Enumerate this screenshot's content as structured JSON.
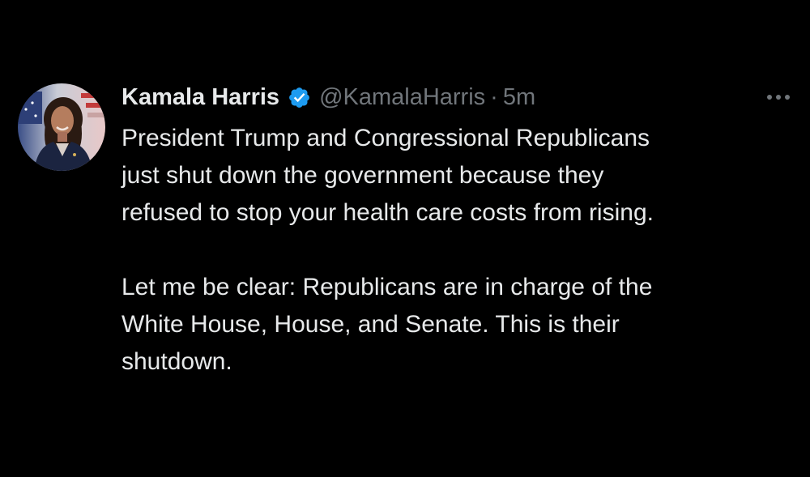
{
  "tweet": {
    "author": {
      "display_name": "Kamala Harris",
      "handle": "@KamalaHarris",
      "verified": true,
      "avatar_icon": "profile-photo"
    },
    "separator": "·",
    "timestamp": "5m",
    "more_icon": "more-horizontal-icon",
    "paragraphs": [
      {
        "lines": [
          "President Trump and Congressional Republicans",
          "just shut down the government because they",
          "refused to stop your health care costs from rising."
        ]
      },
      {
        "lines": [
          "Let me be clear: Republicans are in charge of the",
          "White House, House, and Senate. This is their",
          "shutdown."
        ]
      }
    ]
  },
  "colors": {
    "background": "#000000",
    "primary_text": "#e7e9ea",
    "secondary_text": "#71767b",
    "verified_badge": "#1d9bf0"
  }
}
